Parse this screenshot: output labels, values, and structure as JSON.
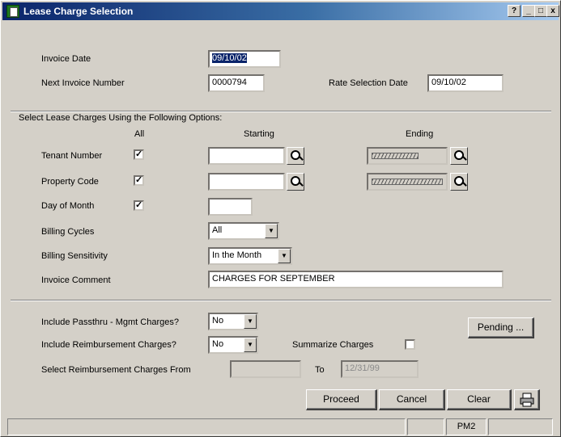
{
  "window": {
    "title": "Lease Charge Selection",
    "help_label": "?",
    "min_label": "_",
    "max_label": "□",
    "close_label": "x"
  },
  "form": {
    "invoice_date_label": "Invoice Date",
    "invoice_date_value": "09/10/02",
    "next_invoice_label": "Next Invoice Number",
    "next_invoice_value": "0000794",
    "rate_selection_label": "Rate Selection Date",
    "rate_selection_value": "09/10/02"
  },
  "options": {
    "section_label": "Select Lease Charges Using the Following Options:",
    "col_all": "All",
    "col_starting": "Starting",
    "col_ending": "Ending",
    "check_mark": "✓",
    "tenant_label": "Tenant Number",
    "property_label": "Property Code",
    "day_label": "Day of Month",
    "billing_cycles_label": "Billing Cycles",
    "billing_cycles_value": "All",
    "billing_sensitivity_label": "Billing Sensitivity",
    "billing_sensitivity_value": "In the Month",
    "invoice_comment_label": "Invoice Comment",
    "invoice_comment_value": "CHARGES FOR SEPTEMBER"
  },
  "lower": {
    "passthru_label": "Include Passthru - Mgmt Charges?",
    "passthru_value": "No",
    "reimb_label": "Include Reimbursement Charges?",
    "reimb_value": "No",
    "summarize_label": "Summarize Charges",
    "pending_label": "Pending ...",
    "select_from_label": "Select Reimbursement Charges From",
    "to_label": "To",
    "to_value": "12/31/99"
  },
  "buttons": {
    "proceed": "Proceed",
    "cancel": "Cancel",
    "clear": "Clear"
  },
  "status": {
    "pm2": "PM2"
  },
  "icons": {
    "app": "document-app-icon",
    "lookup": "magnifier-icon",
    "dropdown": "chevron-down-icon",
    "printer": "printer-icon"
  }
}
